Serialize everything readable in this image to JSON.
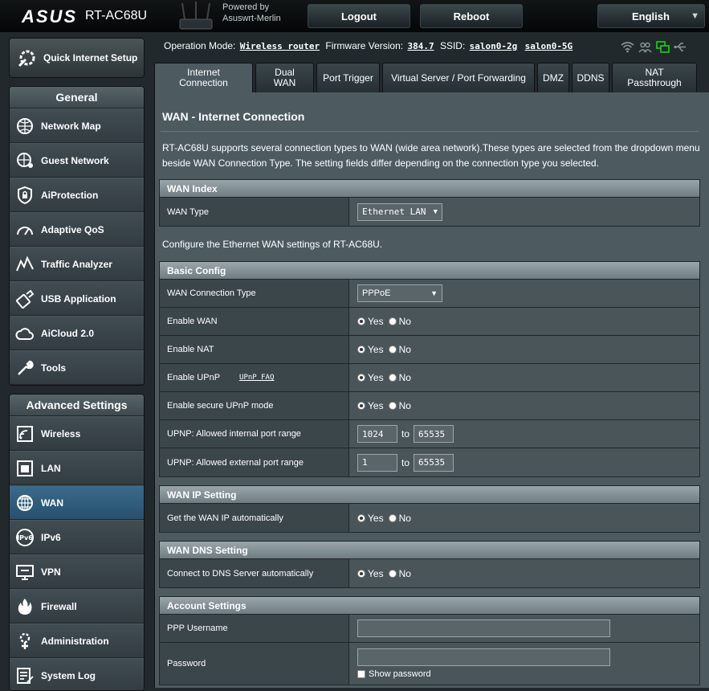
{
  "header": {
    "brand": "ASUS",
    "model": "RT-AC68U",
    "powered_line1": "Powered by",
    "powered_line2": "Asuswrt-Merlin",
    "logout": "Logout",
    "reboot": "Reboot",
    "language": "English"
  },
  "status": {
    "mode_label": "Operation Mode:",
    "mode_value": "Wireless router",
    "fw_label": "Firmware Version:",
    "fw_value": "384.7",
    "ssid_label": "SSID:",
    "ssid1": "salon0-2g",
    "ssid2": "salon0-5G",
    "icons": [
      "wifi-icon",
      "users-icon",
      "network-icon",
      "usb-icon"
    ]
  },
  "sidebar": {
    "qis": "Quick Internet Setup",
    "general_title": "General",
    "general": [
      {
        "label": "Network Map",
        "icon": "network-map-icon"
      },
      {
        "label": "Guest Network",
        "icon": "guest-network-icon"
      },
      {
        "label": "AiProtection",
        "icon": "aiprotection-icon"
      },
      {
        "label": "Adaptive QoS",
        "icon": "qos-icon"
      },
      {
        "label": "Traffic Analyzer",
        "icon": "traffic-analyzer-icon"
      },
      {
        "label": "USB Application",
        "icon": "usb-application-icon"
      },
      {
        "label": "AiCloud 2.0",
        "icon": "aicloud-icon"
      },
      {
        "label": "Tools",
        "icon": "tools-icon"
      }
    ],
    "advanced_title": "Advanced Settings",
    "advanced": [
      {
        "label": "Wireless",
        "icon": "wireless-icon"
      },
      {
        "label": "LAN",
        "icon": "lan-icon"
      },
      {
        "label": "WAN",
        "icon": "wan-icon"
      },
      {
        "label": "IPv6",
        "icon": "ipv6-icon"
      },
      {
        "label": "VPN",
        "icon": "vpn-icon"
      },
      {
        "label": "Firewall",
        "icon": "firewall-icon"
      },
      {
        "label": "Administration",
        "icon": "administration-icon"
      },
      {
        "label": "System Log",
        "icon": "system-log-icon"
      }
    ]
  },
  "tabs": [
    {
      "line1": "Internet",
      "line2": "Connection"
    },
    {
      "line1": "Dual",
      "line2": "WAN"
    },
    {
      "line1": "Port Trigger",
      "line2": ""
    },
    {
      "line1": "Virtual Server / Port Forwarding",
      "line2": ""
    },
    {
      "line1": "DMZ",
      "line2": ""
    },
    {
      "line1": "DDNS",
      "line2": ""
    },
    {
      "line1": "NAT Passthrough",
      "line2": ""
    }
  ],
  "main": {
    "title": "WAN - Internet Connection",
    "description": "RT-AC68U supports several connection types to WAN (wide area network).These types are selected from the dropdown menu beside WAN Connection Type. The setting fields differ depending on the connection type you selected.",
    "eth_desc": "Configure the Ethernet WAN settings of RT-AC68U.",
    "yes": "Yes",
    "no": "No",
    "to": "to",
    "wan_index": {
      "title": "WAN Index",
      "wan_type_label": "WAN Type",
      "wan_type_value": "Ethernet LAN"
    },
    "basic": {
      "title": "Basic Config",
      "conn_type_label": "WAN Connection Type",
      "conn_type_value": "PPPoE",
      "enable_wan": "Enable WAN",
      "enable_nat": "Enable NAT",
      "enable_upnp": "Enable UPnP",
      "upnp_faq": "UPnP  FAQ",
      "secure_upnp": "Enable secure UPnP mode",
      "int_range_label": "UPNP: Allowed internal port range",
      "int_from": "1024",
      "int_to": "65535",
      "ext_range_label": "UPNP: Allowed external port range",
      "ext_from": "1",
      "ext_to": "65535"
    },
    "wan_ip": {
      "title": "WAN IP Setting",
      "auto_label": "Get the WAN IP automatically"
    },
    "dns": {
      "title": "WAN DNS Setting",
      "auto_label": "Connect to DNS Server automatically"
    },
    "account": {
      "title": "Account Settings",
      "user_label": "PPP Username",
      "user_value": "",
      "pass_label": "Password",
      "pass_value": "",
      "show_password": "Show password"
    }
  }
}
